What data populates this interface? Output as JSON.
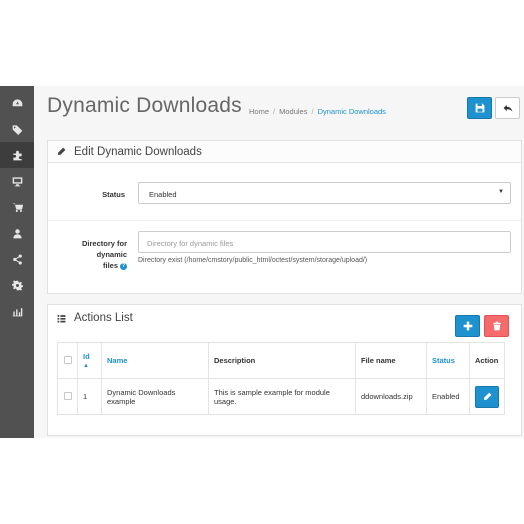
{
  "sidebar": {
    "items": [
      {
        "icon": "dashboard-icon"
      },
      {
        "icon": "tags-icon"
      },
      {
        "icon": "puzzle-icon",
        "active": true
      },
      {
        "icon": "monitor-icon"
      },
      {
        "icon": "cart-icon"
      },
      {
        "icon": "user-icon"
      },
      {
        "icon": "share-icon"
      },
      {
        "icon": "cog-icon"
      },
      {
        "icon": "bar-chart-icon"
      }
    ]
  },
  "header": {
    "title": "Dynamic Downloads",
    "breadcrumb": [
      "Home",
      "Modules",
      "Dynamic Downloads"
    ]
  },
  "toolbar": {
    "save_icon": "save-icon",
    "back_icon": "reply-icon"
  },
  "edit_panel": {
    "title": "Edit Dynamic Downloads",
    "status_label": "Status",
    "status_value": "Enabled",
    "directory_label_line1": "Directory for",
    "directory_label_line2": "dynamic",
    "directory_label_line3": "files",
    "directory_placeholder": "Directory for dynamic files",
    "directory_help": "Directory exist (/home/cmstory/public_html/octest/system/storage/upload/)"
  },
  "actions_panel": {
    "title": "Actions List",
    "columns": [
      "Id",
      "Name",
      "Description",
      "File name",
      "Status",
      "Action"
    ],
    "rows": [
      {
        "id": "1",
        "name": "Dynamic Downloads example",
        "description": "This is sample example for module usage.",
        "file_name": "ddownloads.zip",
        "status": "Enabled"
      }
    ]
  },
  "colors": {
    "primary": "#1e91cf",
    "danger": "#f56b6b",
    "sidebar": "#515151"
  }
}
